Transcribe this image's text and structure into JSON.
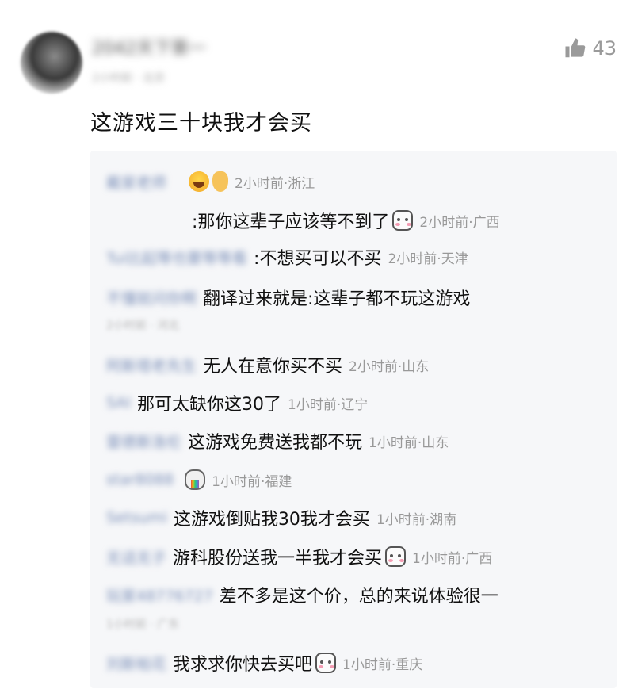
{
  "comment": {
    "username": "2042天下第一",
    "user_meta": "2小时前 · 北京",
    "like_count": "43",
    "text": "这游戏三十块我才会买"
  },
  "replies": [
    {
      "name": "戴家老师",
      "text": "",
      "emoji": [
        "laugh-emoji",
        "ok-hand-emoji"
      ],
      "meta": "2小时前·浙江"
    },
    {
      "name": "",
      "text": ":那你这辈子应该等不到了",
      "emoji": [
        "cute-face-emoji"
      ],
      "meta": "2小时前·广西"
    },
    {
      "name": "Tui比起等也要等等看",
      "text": ":不想买可以不买",
      "emoji": [],
      "meta": "2小时前·天津"
    },
    {
      "name": "不懂就问你啊",
      "text": "翻译过来就是:这辈子都不玩这游戏",
      "emoji": [],
      "meta": "",
      "sub": "2小时前 · 河北"
    },
    {
      "name": "阿斯塔老先生",
      "text": "无人在意你买不买",
      "emoji": [],
      "meta": "2小时前·山东"
    },
    {
      "name": "SAI",
      "text": "那可太缺你这30了",
      "emoji": [],
      "meta": "1小时前·辽宁"
    },
    {
      "name": "雷德斯洛伦",
      "text": "这游戏免费送我都不玩",
      "emoji": [],
      "meta": "1小时前·山东"
    },
    {
      "name": "star8088",
      "text": "",
      "emoji": [
        "rainbow-vomit-emoji"
      ],
      "meta": "1小时前·福建"
    },
    {
      "name": "Setsumi",
      "text": "这游戏倒贴我30我才会买",
      "emoji": [],
      "meta": "1小时前·湖南"
    },
    {
      "name": "无话无子",
      "text": "游科股份送我一半我才会买",
      "emoji": [
        "cute-face-emoji"
      ],
      "meta": "1小时前·广西"
    },
    {
      "name": "玩家48776727",
      "text": "差不多是这个价，总的来说体验很一",
      "emoji": [],
      "meta": "",
      "sub": "1小时前 · 广东"
    },
    {
      "name": "刘斯帕花",
      "text": "我求求你快去买吧",
      "emoji": [
        "cute-face-emoji"
      ],
      "meta": "1小时前·重庆"
    }
  ]
}
